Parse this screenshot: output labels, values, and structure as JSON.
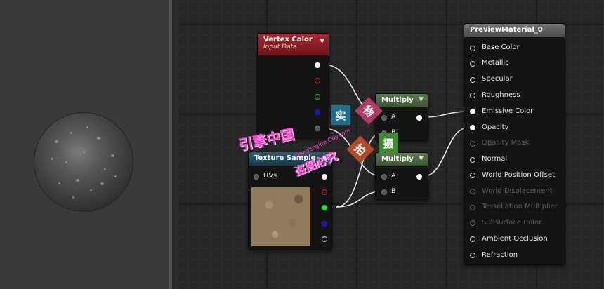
{
  "preview_panel": {
    "label": "material-preview-sphere"
  },
  "nodes": {
    "vertex_color": {
      "title": "Vertex Color",
      "subtitle": "Input Data",
      "collapse_glyph": "▼"
    },
    "texture_sample": {
      "title": "Texture Sample",
      "collapse_glyph": "▲",
      "input_uvs": "UVs"
    },
    "multiply_top": {
      "title": "Multiply",
      "collapse_glyph": "▼",
      "input_a": "A",
      "input_b": "B"
    },
    "multiply_bottom": {
      "title": "Multiply",
      "collapse_glyph": "▼",
      "input_a": "A",
      "input_b": "B"
    },
    "preview_material": {
      "title": "PreviewMaterial_0",
      "inputs": [
        "Base Color",
        "Metallic",
        "Specular",
        "Roughness",
        "Emissive Color",
        "Opacity",
        "Opacity Mask",
        "Normal",
        "World Position Offset",
        "World Displacement",
        "Tessellation Multiplier",
        "Subsurface Color",
        "Ambient Occlusion",
        "Refraction"
      ]
    }
  },
  "colors": {
    "vertex_header": "#8b1b22",
    "multiply_header": "#4f6a44",
    "texture_header": "#23485a",
    "material_header": "#5a5a5a",
    "wire": "#e8e8e8"
  },
  "watermark": {
    "main": "引擎中国",
    "sub": "盗图必究",
    "url": "ChinaEngine.Ody.com",
    "badge_1": "实",
    "badge_2": "物",
    "badge_3": "拍",
    "badge_4": "摄"
  }
}
